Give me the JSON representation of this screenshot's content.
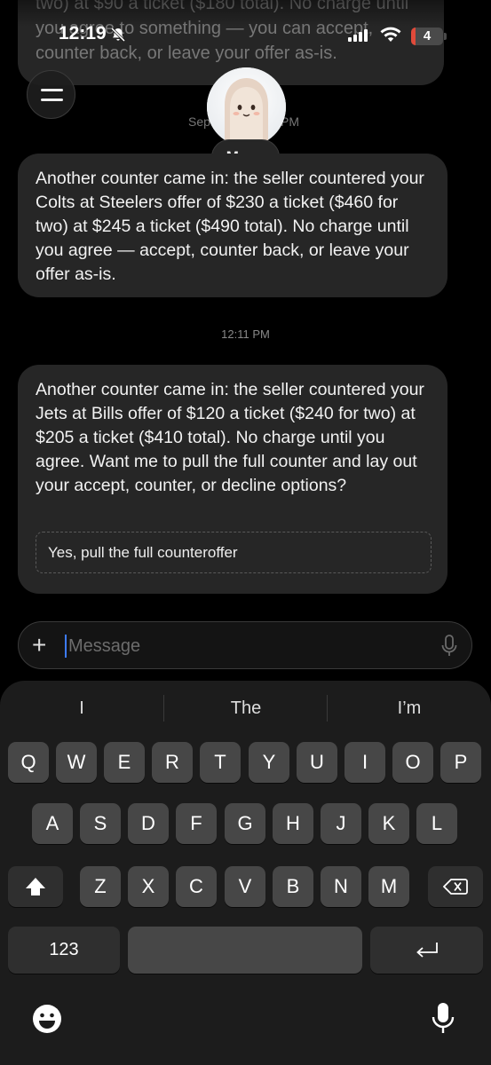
{
  "status_bar": {
    "time": "12:19",
    "battery": "4"
  },
  "previous_message": {
    "text": "two) at $90 a ticket ($180 total). No charge until you agree to something — you can accept, counter back, or leave your offer as-is."
  },
  "header": {
    "agent_name": "Muse",
    "date_left": "Sep",
    "date_right": "PM"
  },
  "messages": [
    {
      "text": "Another counter came in: the seller countered your Colts at Steelers offer of $230 a ticket ($460 for two) at $245 a ticket ($490 total). No charge until you agree — accept, counter back, or leave your offer as-is."
    },
    {
      "timestamp": "12:11 PM"
    },
    {
      "text": "Another counter came in: the seller countered your Jets at Bills offer of $120 a ticket ($240 for two) at $205 a ticket ($410 total). No charge until you agree. Want me to pull the full counter and lay out your accept, counter, or decline options?",
      "suggestion": "Yes, pull the full counteroffer"
    }
  ],
  "composer": {
    "placeholder": "Message"
  },
  "keyboard": {
    "suggestions": [
      "I",
      "The",
      "I’m"
    ],
    "row1": [
      "Q",
      "W",
      "E",
      "R",
      "T",
      "Y",
      "U",
      "I",
      "O",
      "P"
    ],
    "row2": [
      "A",
      "S",
      "D",
      "F",
      "G",
      "H",
      "J",
      "K",
      "L"
    ],
    "row3": [
      "Z",
      "X",
      "C",
      "V",
      "B",
      "N",
      "M"
    ],
    "numbers_label": "123"
  }
}
